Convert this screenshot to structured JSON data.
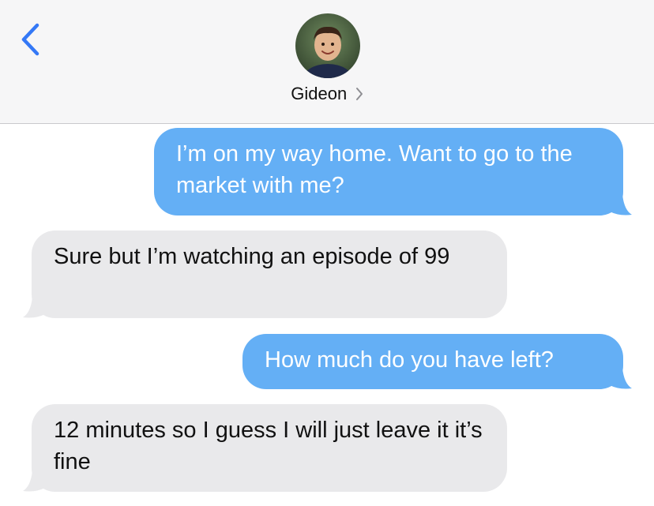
{
  "header": {
    "contact_name": "Gideon",
    "back_icon": "chevron-left-icon",
    "detail_icon": "chevron-right-icon",
    "accent_color": "#3478f6"
  },
  "colors": {
    "sent_bubble": "#64aff5",
    "received_bubble": "#e9e9eb"
  },
  "messages": [
    {
      "direction": "sent",
      "text": "I’m on my way home. Want to go to the market with me?"
    },
    {
      "direction": "received",
      "text": "Sure but I’m watching an episode of 99"
    },
    {
      "direction": "sent",
      "text": "How much do you have left?"
    },
    {
      "direction": "received",
      "text": "12 minutes so I guess I will just leave it it’s fine"
    }
  ]
}
